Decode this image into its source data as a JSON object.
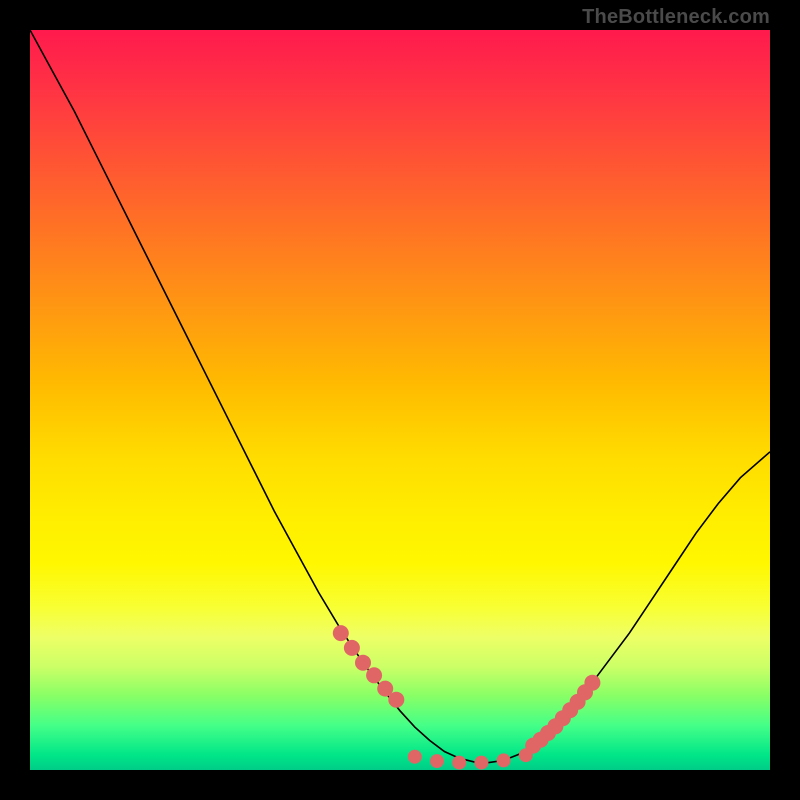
{
  "watermark": "TheBottleneck.com",
  "colors": {
    "curve": "#000000",
    "marker": "#e06666",
    "background_top": "#ff1a4d",
    "background_bottom": "#00cc88"
  },
  "chart_data": {
    "type": "line",
    "title": "",
    "xlabel": "",
    "ylabel": "",
    "xlim": [
      0,
      100
    ],
    "ylim": [
      0,
      100
    ],
    "x": [
      0,
      3,
      6,
      9,
      12,
      15,
      18,
      21,
      24,
      27,
      30,
      33,
      36,
      39,
      42,
      45,
      48,
      50,
      52,
      54,
      56,
      58,
      60,
      62,
      64,
      66,
      68,
      70,
      72,
      75,
      78,
      81,
      84,
      87,
      90,
      93,
      96,
      100
    ],
    "y": [
      100,
      94.5,
      89,
      83,
      77,
      71,
      65,
      59,
      53,
      47,
      41,
      35,
      29.5,
      24,
      19,
      14.5,
      10.5,
      8,
      5.8,
      4,
      2.5,
      1.6,
      1.1,
      1.0,
      1.3,
      2.1,
      3.3,
      5.0,
      7.0,
      10.5,
      14.5,
      18.5,
      23,
      27.5,
      32,
      36,
      39.5,
      43
    ],
    "markers": {
      "left_segment_x": [
        42,
        43.5,
        45,
        46.5,
        48,
        49.5
      ],
      "left_segment_y": [
        18.5,
        16.5,
        14.5,
        12.8,
        11,
        9.5
      ],
      "right_segment_x": [
        68,
        69,
        70,
        71,
        72,
        73,
        74,
        75,
        76
      ],
      "right_segment_y": [
        3.3,
        4.1,
        5.0,
        5.9,
        7.0,
        8.1,
        9.2,
        10.5,
        11.8
      ],
      "bottom_dots_x": [
        52,
        55,
        58,
        61,
        64,
        67
      ],
      "bottom_dots_y": [
        1.8,
        1.2,
        1.0,
        1.0,
        1.3,
        2.0
      ]
    }
  }
}
